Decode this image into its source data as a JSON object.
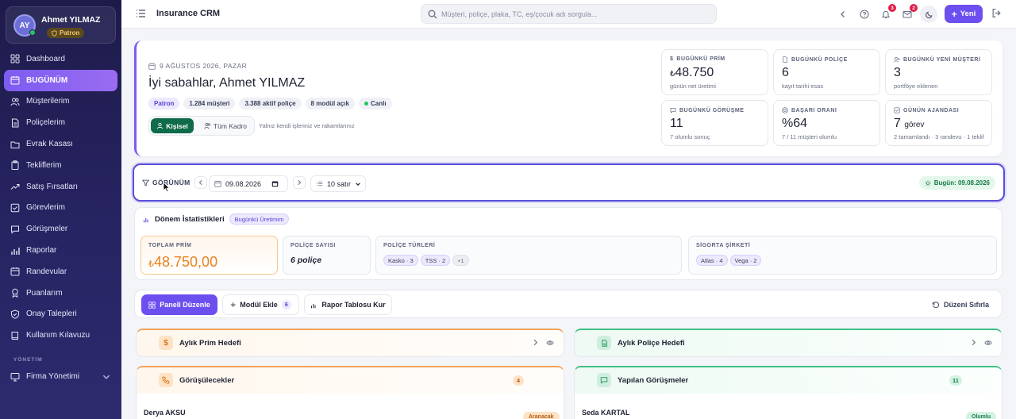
{
  "user": {
    "initials": "AY",
    "name": "Ahmet YILMAZ",
    "role": "Patron"
  },
  "sidebar": {
    "items": [
      {
        "label": "Dashboard",
        "icon": "grid-icon"
      },
      {
        "label": "BUGÜNÜM",
        "icon": "calendar-icon",
        "active": true
      },
      {
        "label": "Müşterilerim",
        "icon": "users-icon"
      },
      {
        "label": "Poliçelerim",
        "icon": "document-icon"
      },
      {
        "label": "Evrak Kasası",
        "icon": "folder-icon"
      },
      {
        "label": "Tekliflerim",
        "icon": "clipboard-icon"
      },
      {
        "label": "Satış Fırsatları",
        "icon": "trending-up-icon"
      },
      {
        "label": "Görevlerim",
        "icon": "check-square-icon"
      },
      {
        "label": "Görüşmeler",
        "icon": "message-icon"
      },
      {
        "label": "Raporlar",
        "icon": "bar-chart-icon"
      },
      {
        "label": "Randevular",
        "icon": "calendar-icon"
      },
      {
        "label": "Puanlarım",
        "icon": "award-icon"
      },
      {
        "label": "Onay Talepleri",
        "icon": "shield-check-icon"
      },
      {
        "label": "Kullanım Kılavuzu",
        "icon": "book-icon"
      }
    ],
    "section_label": "YÖNETİM",
    "admin_item": "Firma Yönetimi"
  },
  "topbar": {
    "title": "Insurance CRM",
    "search_placeholder": "Müşteri, poliçe, plaka, TC, eş/çocuk adı sorgula...",
    "notif_count": "3",
    "mail_count": "2",
    "new_label": "Yeni"
  },
  "hero": {
    "date": "9 AĞUSTOS 2026, PAZAR",
    "greeting": "İyi sabahlar, Ahmet YILMAZ",
    "chips": {
      "role": "Patron",
      "customers": "1.284 müşteri",
      "policies": "3.388 aktif poliçe",
      "modules": "8 modül açık",
      "live": "Canlı"
    },
    "seg_personal": "Kişisel",
    "seg_all": "Tüm Kadro",
    "seg_note": "Yalnız kendi işleriniz ve rakamlarınız",
    "stats": [
      {
        "label": "BUGÜNKÜ PRİM",
        "currency": "₺",
        "value": "48.750",
        "sub": "günün net üretimi"
      },
      {
        "label": "BUGÜNKÜ POLİÇE",
        "value": "6",
        "sub": "kayıt tarihi esas"
      },
      {
        "label": "BUGÜNKÜ YENİ MÜŞTERİ",
        "value": "3",
        "sub": "portföye eklenen"
      },
      {
        "label": "BUGÜNKÜ GÖRÜŞME",
        "value": "11",
        "sub": "7 olumlu sonuç"
      },
      {
        "label": "BAŞARI ORANI",
        "value": "%64",
        "sub": "7 / 11 müşteri olumlu"
      },
      {
        "label": "GÜNÜN AJANDASI",
        "value": "7",
        "unit": "görev",
        "sub": "2 tamamlandı · 3 randevu · 1 teklif"
      }
    ]
  },
  "filter": {
    "label": "GÖRÜNÜM",
    "date": "09.08.2026",
    "rows": "10 satır",
    "today": "Bugün: 09.08.2026"
  },
  "period": {
    "title": "Dönem İstatistikleri",
    "tag": "Bugünkü Üretimim",
    "total_label": "TOPLAM PRİM",
    "total_currency": "₺",
    "total_value": "48.750,00",
    "count_label": "POLİÇE SAYISI",
    "count_value": "6 poliçe",
    "types_label": "POLİÇE TÜRLERİ",
    "types": [
      "Kasko · 3",
      "TSS · 2",
      "+1"
    ],
    "companies_label": "SİGORTA ŞİRKETİ",
    "companies": [
      "Atlas · 4",
      "Vega · 2"
    ]
  },
  "toolbar": {
    "edit_label": "Paneli Düzenle",
    "add_label": "Modül Ekle",
    "add_count": "6",
    "report_label": "Rapor Tablosu Kur",
    "reset_label": "Düzeni Sıfırla"
  },
  "modules": {
    "monthly_premium": "Aylık Prim Hedefi",
    "monthly_policy": "Aylık Poliçe Hedefi",
    "to_call": {
      "title": "Görüşülecekler",
      "count": "4",
      "first_name": "Derya AKSU",
      "first_status": "Aranacak"
    },
    "done_calls": {
      "title": "Yapılan Görüşmeler",
      "count": "11",
      "first_name": "Seda KARTAL",
      "first_status": "Olumlu"
    }
  }
}
